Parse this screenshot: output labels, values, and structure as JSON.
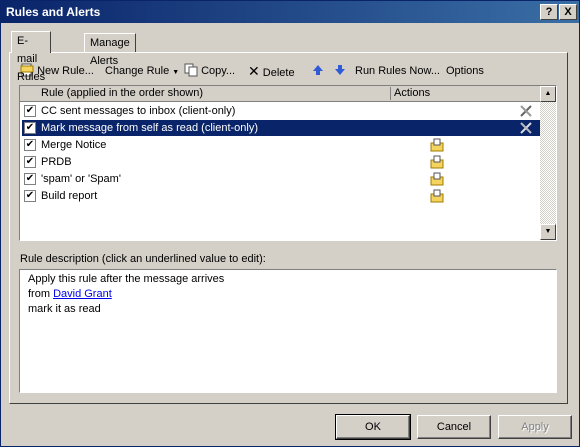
{
  "window": {
    "title": "Rules and Alerts",
    "help_label": "?",
    "close_label": "X"
  },
  "tabs": [
    {
      "label": "E-mail Rules"
    },
    {
      "label": "Manage Alerts"
    }
  ],
  "toolbar": {
    "new_rule": "New Rule...",
    "change_rule": "Change Rule",
    "copy": "Copy...",
    "delete": "Delete",
    "run_rules_now": "Run Rules Now...",
    "options": "Options"
  },
  "rules_list": {
    "col_rule": "Rule (applied in the order shown)",
    "col_actions": "Actions",
    "rows": [
      {
        "label": "CC sent messages to inbox  (client-only)",
        "checked": true,
        "selected": false,
        "action_icon": "client-only-icon"
      },
      {
        "label": "Mark message from self as read  (client-only)",
        "checked": true,
        "selected": true,
        "action_icon": "client-only-icon"
      },
      {
        "label": "Merge Notice",
        "checked": true,
        "selected": false,
        "action_icon": "move-to-folder-icon"
      },
      {
        "label": "PRDB",
        "checked": true,
        "selected": false,
        "action_icon": "move-to-folder-icon"
      },
      {
        "label": "'spam' or 'Spam'",
        "checked": true,
        "selected": false,
        "action_icon": "move-to-folder-icon"
      },
      {
        "label": "Build report",
        "checked": true,
        "selected": false,
        "action_icon": "move-to-folder-icon"
      }
    ]
  },
  "description": {
    "label": "Rule description (click an underlined value to edit):",
    "line1": "Apply this rule after the message arrives",
    "line2_prefix": "from ",
    "line2_link": "David Grant",
    "line3": "mark it as read"
  },
  "buttons": {
    "ok": "OK",
    "cancel": "Cancel",
    "apply": "Apply"
  }
}
